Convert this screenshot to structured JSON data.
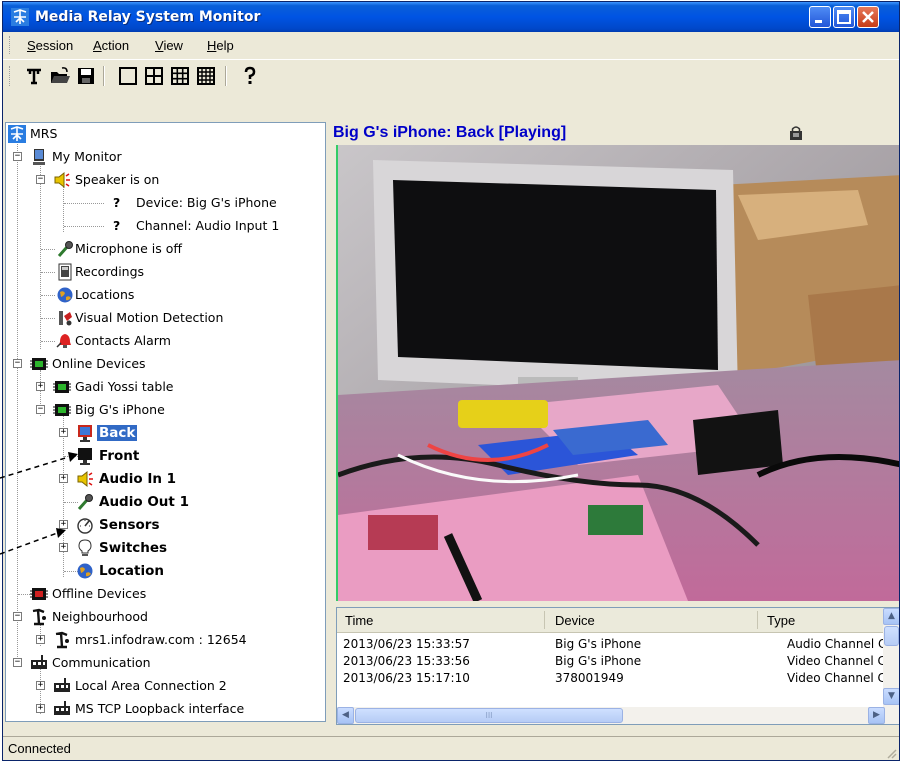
{
  "window": {
    "title": "Media Relay System Monitor",
    "controls": [
      "minimize",
      "maximize",
      "close"
    ]
  },
  "menu": {
    "items": [
      {
        "label": "Session",
        "underline": "S",
        "rest": "ession"
      },
      {
        "label": "Action",
        "underline": "A",
        "rest": "ction"
      },
      {
        "label": "View",
        "underline": "V",
        "rest": "iew"
      },
      {
        "label": "Help",
        "underline": "H",
        "rest": "elp"
      }
    ]
  },
  "toolbar": {
    "icons": [
      "connect-icon",
      "open-icon",
      "save-icon",
      "layout-1x1-icon",
      "layout-2x2-icon",
      "layout-3x3-icon",
      "layout-4x4-icon",
      "help-icon"
    ]
  },
  "tree": {
    "root": "MRS",
    "my_monitor": "My Monitor",
    "speaker": "Speaker is on",
    "device": "Device: Big G's iPhone",
    "channel": "Channel: Audio Input 1",
    "microphone": "Microphone is off",
    "recordings": "Recordings",
    "locations": "Locations",
    "visual_motion": "Visual Motion Detection",
    "contacts_alarm": "Contacts Alarm",
    "online_devices": "Online Devices",
    "gadi": "Gadi Yossi table",
    "iphone": "Big G's iPhone",
    "back": "Back",
    "front": "Front",
    "audio_in": "Audio In 1",
    "audio_out": "Audio Out 1",
    "sensors": "Sensors",
    "switches": "Switches",
    "location": "Location",
    "offline_devices": "Offline Devices",
    "neighbourhood": "Neighbourhood",
    "mrs1": "mrs1.infodraw.com : 12654",
    "communication": "Communication",
    "lan": "Local Area Connection 2",
    "loopback": "MS TCP Loopback interface",
    "unknown_mark": "?"
  },
  "video": {
    "title": "Big G's iPhone: Back [Playing]"
  },
  "log": {
    "columns": [
      "Time",
      "Device",
      "Type"
    ],
    "rows": [
      {
        "time": "2013/06/23 15:33:57",
        "device": "Big G's iPhone",
        "type": "Audio Channel C"
      },
      {
        "time": "2013/06/23 15:33:56",
        "device": "Big G's iPhone",
        "type": "Video Channel C"
      },
      {
        "time": "2013/06/23 15:17:10",
        "device": "378001949",
        "type": "Video Channel C"
      }
    ],
    "scroll_mark": "III"
  },
  "status": {
    "text": "Connected"
  },
  "colors": {
    "title_blue": "#0054e3",
    "selection": "#316ac5",
    "video_title": "#0000c8"
  }
}
